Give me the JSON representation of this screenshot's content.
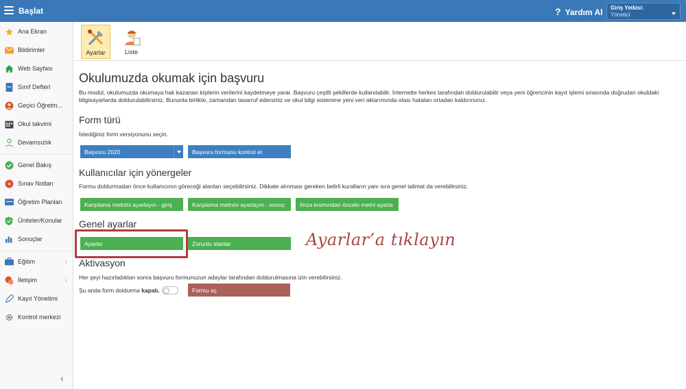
{
  "topbar": {
    "title": "Başlat",
    "help_label": "Yardım Al",
    "role_label": "Giriş Yetkisi:",
    "role_value": "Yönetici"
  },
  "sidebar": {
    "items": [
      {
        "label": "Ana Ekran",
        "icon": "star-icon",
        "color": "#f2b01e"
      },
      {
        "label": "Bildirimler",
        "icon": "envelope-icon",
        "color": "#f0a030"
      },
      {
        "label": "Web Sayfası",
        "icon": "home-icon",
        "color": "#2e9e4f"
      },
      {
        "label": "Sınıf Defteri",
        "icon": "notebook-icon",
        "color": "#3a78b7"
      },
      {
        "label": "Geçici Öğretm...",
        "icon": "teacher-icon",
        "color": "#d9542c"
      },
      {
        "label": "Okul takvimi",
        "icon": "calendar-icon",
        "color": "#444444"
      },
      {
        "label": "Devamsızlık",
        "icon": "person-icon",
        "color": "#4caf50"
      },
      {
        "label": "Genel Bakış",
        "icon": "check-circle-icon",
        "color": "#4caf50"
      },
      {
        "label": "Sınav Notları",
        "icon": "grade-icon",
        "color": "#e05030"
      },
      {
        "label": "Öğretim Planları",
        "icon": "plan-icon",
        "color": "#3a78b7"
      },
      {
        "label": "Üniteler/Konular",
        "icon": "shield-icon",
        "color": "#4caf50"
      },
      {
        "label": "Sonuçlar",
        "icon": "bar-chart-icon",
        "color": "#3a78b7"
      },
      {
        "label": "Eğitim",
        "icon": "briefcase-icon",
        "color": "#3a78b7"
      },
      {
        "label": "İletişim",
        "icon": "chat-icon",
        "color": "#d9542c"
      },
      {
        "label": "Kayıt Yönetimi",
        "icon": "pen-icon",
        "color": "#3a78b7"
      },
      {
        "label": "Kontrol merkezi",
        "icon": "gear-icon",
        "color": "#777777"
      }
    ]
  },
  "toolbar": {
    "settings_label": "Ayarlar",
    "list_label": "Liste"
  },
  "main": {
    "title": "Okulumuzda okumak için başvuru",
    "description": "Bu modül, okulumuzda okumaya hak kazanan kişilerin verilerini kaydetmeye yarar. Başvuru çeşitli şekillerde kullanılabilir. İnternette herkes tarafından doldurulabilir veya yeni öğrencinin kayıt işlemi sırasında doğrudan okuldaki bilgisayarlarda doldurulabilirsiniz. Bununla birlikte, zamandan tasarruf edersiniz ve okul bilgi sistemine yeni veri aktarımında olası hataları ortadan kaldırırsınız.",
    "form_type": {
      "title": "Form türü",
      "hint": "İstediğiniz form versiyonunu seçin.",
      "select_value": "Başvuru 2020",
      "check_button": "Başvuru formunu kontrol et"
    },
    "guidelines": {
      "title": "Kullanıcılar için yönergeler",
      "hint": "Formu doldurmadan önce kullanıcının göreceği alanları seçebilirsiniz. Dikkate alınması gereken belirli kuralların yanı sıra genel talimat da verebilirsiniz.",
      "buttons": [
        "Karşılama metnini ayarlayın - giriş",
        "Karşılama metnini ayarlayın - sonuç",
        "İmza kısmından önceki metni ayarla"
      ]
    },
    "general": {
      "title": "Genel ayarlar",
      "settings_button": "Ayarlar",
      "required_button": "Zorunlu alanlar"
    },
    "activation": {
      "title": "Aktivasyon",
      "hint": "Her şeyi hazırladıktan sonra başvuru formunuzun adaylar tarafından doldurulmasına izin verebilirsiniz.",
      "status_prefix": "Şu anda form doldurma",
      "status_value": "kapalı.",
      "open_button": "Formu aç"
    }
  },
  "annotation": "Ayarlar’a tıklayın"
}
